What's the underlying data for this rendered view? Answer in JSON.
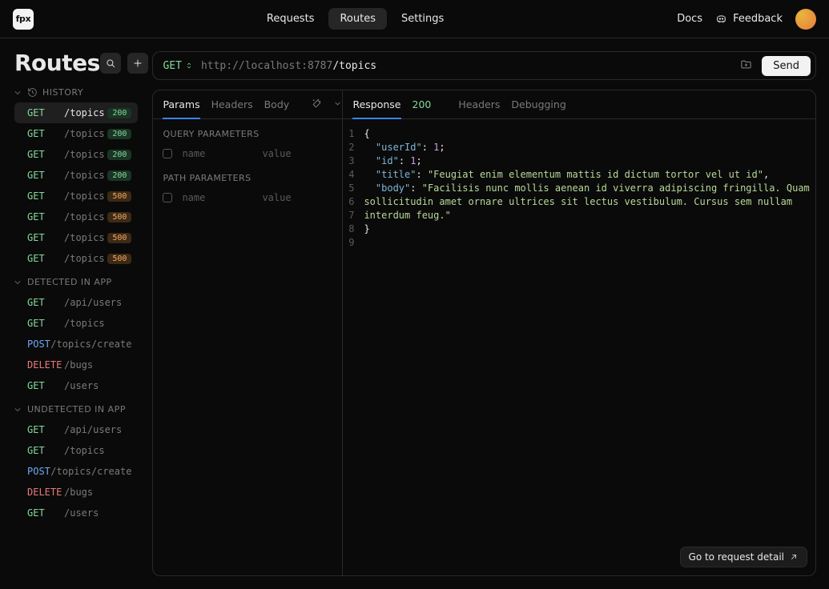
{
  "brand": "fpx",
  "nav": {
    "requests": "Requests",
    "routes": "Routes",
    "settings": "Settings",
    "docs": "Docs",
    "feedback": "Feedback"
  },
  "sidebar": {
    "title": "Routes",
    "groups": [
      {
        "label": "HISTORY",
        "kind": "history",
        "items": [
          {
            "method": "GET",
            "path": "/topics",
            "status": "200",
            "selected": true
          },
          {
            "method": "GET",
            "path": "/topics",
            "status": "200"
          },
          {
            "method": "GET",
            "path": "/topics",
            "status": "200"
          },
          {
            "method": "GET",
            "path": "/topics",
            "status": "200"
          },
          {
            "method": "GET",
            "path": "/topics",
            "status": "500"
          },
          {
            "method": "GET",
            "path": "/topics",
            "status": "500"
          },
          {
            "method": "GET",
            "path": "/topics",
            "status": "500"
          },
          {
            "method": "GET",
            "path": "/topics",
            "status": "500"
          }
        ]
      },
      {
        "label": "DETECTED IN APP",
        "kind": "detected",
        "items": [
          {
            "method": "GET",
            "path": "/api/users"
          },
          {
            "method": "GET",
            "path": "/topics"
          },
          {
            "method": "POST",
            "path": "/topics/create"
          },
          {
            "method": "DELETE",
            "path": "/bugs"
          },
          {
            "method": "GET",
            "path": "/users"
          }
        ]
      },
      {
        "label": "UNDETECTED IN APP",
        "kind": "undetected",
        "items": [
          {
            "method": "GET",
            "path": "/api/users"
          },
          {
            "method": "GET",
            "path": "/topics"
          },
          {
            "method": "POST",
            "path": "/topics/create"
          },
          {
            "method": "DELETE",
            "path": "/bugs"
          },
          {
            "method": "GET",
            "path": "/users"
          }
        ]
      }
    ]
  },
  "urlbar": {
    "method": "GET",
    "host": "http://localhost:8787",
    "path": "/topics",
    "send": "Send"
  },
  "request": {
    "tabs": {
      "params": "Params",
      "headers": "Headers",
      "body": "Body"
    },
    "sections": {
      "query": "QUERY PARAMETERS",
      "path": "PATH PARAMETERS"
    },
    "placeholders": {
      "name": "name",
      "value": "value"
    }
  },
  "response": {
    "tabs": {
      "response": "Response",
      "status": "200",
      "headers": "Headers",
      "debugging": "Debugging"
    },
    "body_lines": [
      [
        {
          "t": "punc",
          "v": "{"
        }
      ],
      [
        {
          "t": "pad",
          "v": "  "
        },
        {
          "t": "key",
          "v": "\"userId\""
        },
        {
          "t": "punc",
          "v": ": "
        },
        {
          "t": "num",
          "v": "1"
        },
        {
          "t": "punc",
          "v": ";"
        }
      ],
      [
        {
          "t": "pad",
          "v": "  "
        },
        {
          "t": "key",
          "v": "\"id\""
        },
        {
          "t": "punc",
          "v": ": "
        },
        {
          "t": "num",
          "v": "1"
        },
        {
          "t": "punc",
          "v": ";"
        }
      ],
      [
        {
          "t": "pad",
          "v": "  "
        },
        {
          "t": "key",
          "v": "\"title\""
        },
        {
          "t": "punc",
          "v": ": "
        },
        {
          "t": "str",
          "v": "\"Feugiat enim elementum mattis id dictum tortor vel ut id\""
        },
        {
          "t": "punc",
          "v": ","
        }
      ],
      [
        {
          "t": "pad",
          "v": "  "
        },
        {
          "t": "key",
          "v": "\"body\""
        },
        {
          "t": "punc",
          "v": ": "
        },
        {
          "t": "str",
          "v": "\"Facilisis nunc mollis aenean id viverra adipiscing fringilla. Quam "
        }
      ],
      [
        {
          "t": "str",
          "v": "sollicitudin amet ornare ultrices sit lectus vestibulum. Cursus sem nullam "
        }
      ],
      [
        {
          "t": "str",
          "v": "interdum feug.\""
        }
      ],
      [
        {
          "t": "punc",
          "v": "}"
        }
      ],
      []
    ]
  },
  "detail_link": "Go to request detail"
}
